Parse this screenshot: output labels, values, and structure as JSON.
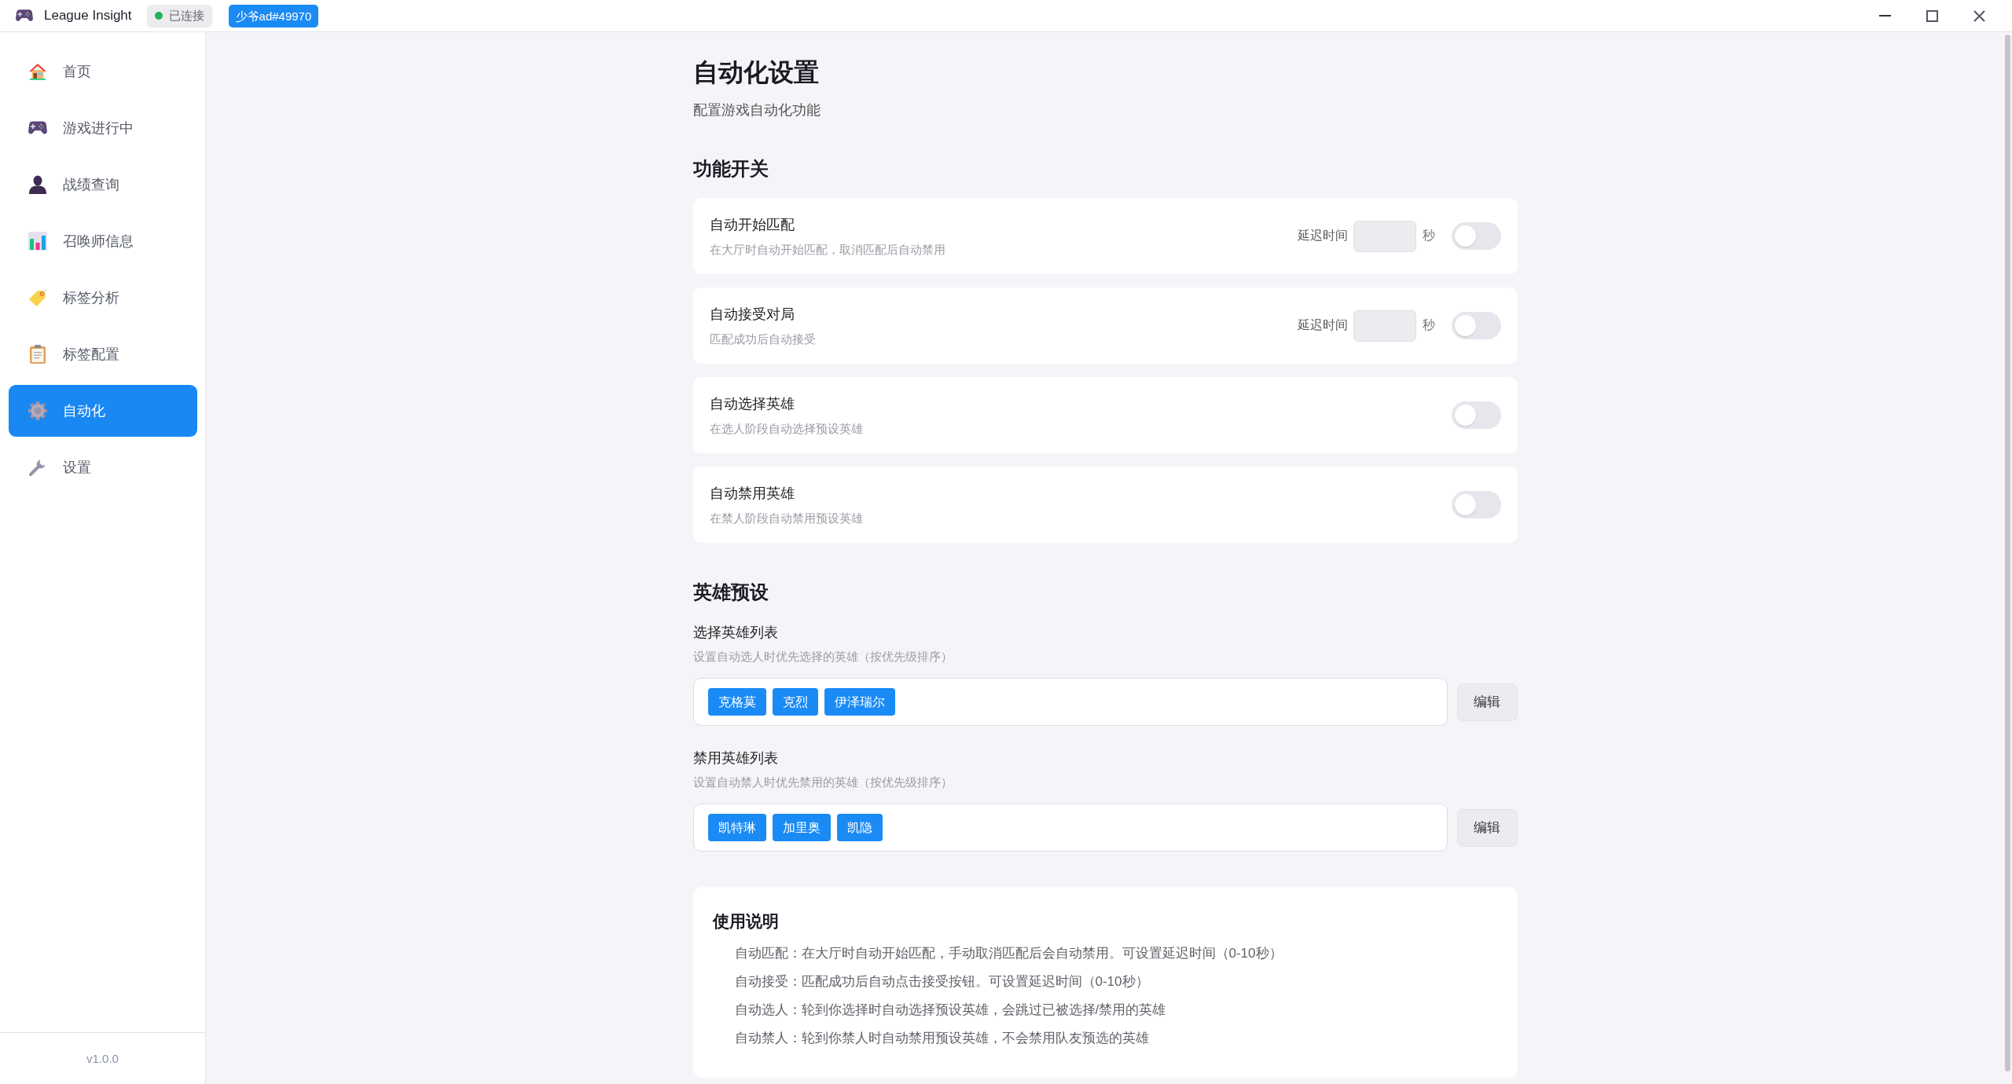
{
  "window": {
    "app_name": "League Insight",
    "connection": {
      "label": "已连接",
      "connected": true
    },
    "user_badge": "少爷ad#49970"
  },
  "sidebar": {
    "items": [
      {
        "label": "首页",
        "selected": false
      },
      {
        "label": "游戏进行中",
        "selected": false
      },
      {
        "label": "战绩查询",
        "selected": false
      },
      {
        "label": "召唤师信息",
        "selected": false
      },
      {
        "label": "标签分析",
        "selected": false
      },
      {
        "label": "标签配置",
        "selected": false
      },
      {
        "label": "自动化",
        "selected": true
      },
      {
        "label": "设置",
        "selected": false
      }
    ],
    "version": "v1.0.0"
  },
  "page": {
    "title": "自动化设置",
    "subtitle": "配置游戏自动化功能"
  },
  "feature_switches": {
    "heading": "功能开关",
    "items": [
      {
        "title": "自动开始匹配",
        "description": "在大厅时自动开始匹配，取消匹配后自动禁用",
        "delay": {
          "label": "延迟时间",
          "unit": "秒"
        },
        "on": false
      },
      {
        "title": "自动接受对局",
        "description": "匹配成功后自动接受",
        "delay": {
          "label": "延迟时间",
          "unit": "秒"
        },
        "on": false
      },
      {
        "title": "自动选择英雄",
        "description": "在选人阶段自动选择预设英雄",
        "on": false
      },
      {
        "title": "自动禁用英雄",
        "description": "在禁人阶段自动禁用预设英雄",
        "on": false
      }
    ]
  },
  "hero_presets": {
    "heading": "英雄预设",
    "lists": [
      {
        "title": "选择英雄列表",
        "description": "设置自动选人时优先选择的英雄（按优先级排序）",
        "heroes": [
          "克格莫",
          "克烈",
          "伊泽瑞尔"
        ],
        "button": "编辑"
      },
      {
        "title": "禁用英雄列表",
        "description": "设置自动禁人时优先禁用的英雄（按优先级排序）",
        "heroes": [
          "凯特琳",
          "加里奥",
          "凯隐"
        ],
        "button": "编辑"
      }
    ]
  },
  "usage": {
    "heading": "使用说明",
    "lines": [
      "自动匹配：在大厅时自动开始匹配，手动取消匹配后会自动禁用。可设置延迟时间（0-10秒）",
      "自动接受：匹配成功后自动点击接受按钮。可设置延迟时间（0-10秒）",
      "自动选人：轮到你选择时自动选择预设英雄，会跳过已被选择/禁用的英雄",
      "自动禁人：轮到你禁人时自动禁用预设英雄，不会禁用队友预选的英雄"
    ]
  }
}
